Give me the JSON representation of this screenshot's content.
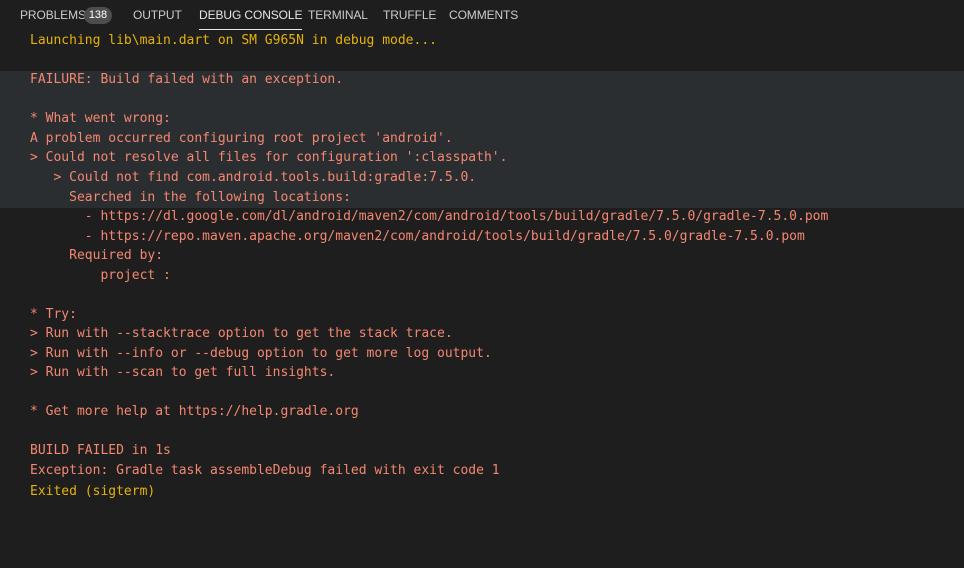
{
  "panel": {
    "tabs": [
      {
        "label": "PROBLEMS",
        "badge": "138"
      },
      {
        "label": "OUTPUT"
      },
      {
        "label": "DEBUG CONSOLE",
        "active": true
      },
      {
        "label": "TERMINAL"
      },
      {
        "label": "TRUFFLE"
      },
      {
        "label": "COMMENTS"
      }
    ]
  },
  "console": {
    "lines": [
      "Launching lib\\main.dart on SM G965N in debug mode...",
      "",
      "FAILURE: Build failed with an exception.",
      "",
      "* What went wrong:",
      "A problem occurred configuring root project 'android'.",
      "> Could not resolve all files for configuration ':classpath'.",
      "   > Could not find com.android.tools.build:gradle:7.5.0.",
      "     Searched in the following locations:",
      "       - https://dl.google.com/dl/android/maven2/com/android/tools/build/gradle/7.5.0/gradle-7.5.0.pom",
      "       - https://repo.maven.apache.org/maven2/com/android/tools/build/gradle/7.5.0/gradle-7.5.0.pom",
      "     Required by:",
      "         project :",
      "",
      "* Try:",
      "> Run with --stacktrace option to get the stack trace.",
      "> Run with --info or --debug option to get more log output.",
      "> Run with --scan to get full insights.",
      "",
      "* Get more help at https://help.gradle.org",
      "",
      "BUILD FAILED in 1s",
      "Exception: Gradle task assembleDebug failed with exit code 1",
      "Exited (sigterm)"
    ]
  },
  "colors": {
    "background": "#1e1e1e",
    "highlight_band": "#2b2e30",
    "error_text": "#f48771",
    "info_text": "#e5b20a",
    "tab_text": "#cccccc",
    "tab_active": "#e7e7e7",
    "badge_bg": "#4d4d4d"
  }
}
